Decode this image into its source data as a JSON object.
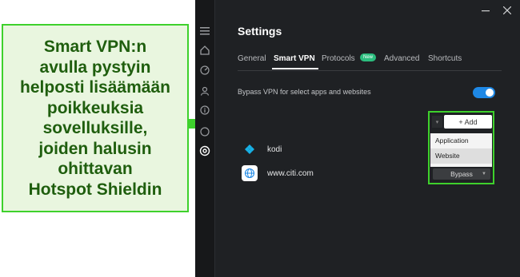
{
  "annotation": {
    "text": "Smart VPN:n\navulla pystyin\nhelposti lisäämään\npoikkeuksia\nsovelluksille,\njoiden halusin\nohittavan\nHotspot Shieldin"
  },
  "window": {
    "title": "Settings"
  },
  "tabs": [
    {
      "label": "General"
    },
    {
      "label": "Smart VPN"
    },
    {
      "label": "Protocols"
    },
    {
      "label": "Advanced"
    },
    {
      "label": "Shortcuts"
    }
  ],
  "protocols_badge": "New",
  "bypass_setting": {
    "label": "Bypass VPN for select apps and websites",
    "enabled": true
  },
  "add_button": {
    "label": "+ Add"
  },
  "add_menu": {
    "items": [
      "Application",
      "Website"
    ]
  },
  "entries": [
    {
      "name": "kodi",
      "icon": "kodi-icon"
    },
    {
      "name": "www.citi.com",
      "icon": "globe-icon"
    }
  ],
  "mode_select": {
    "value": "Bypass"
  },
  "colors": {
    "annotation_border": "#3ed12c",
    "annotation_text": "#1f5e0e",
    "toggle_on": "#1e88e5",
    "badge": "#2bbd7e",
    "app_bg": "#1f2124"
  }
}
